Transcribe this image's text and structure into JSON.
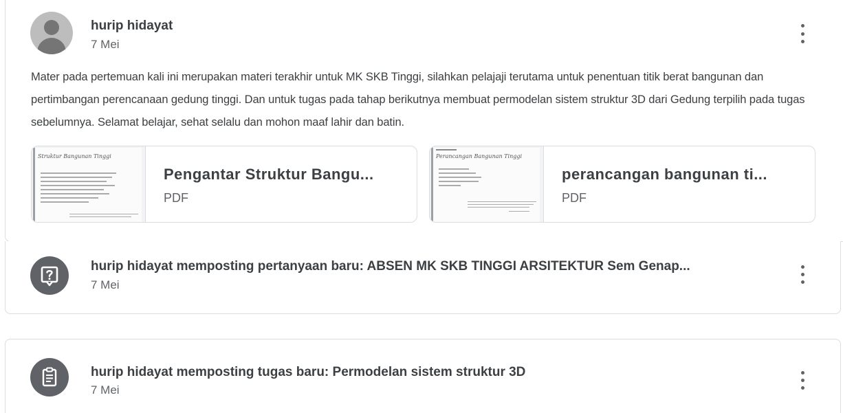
{
  "announcement": {
    "author": "hurip hidayat",
    "date": "7 Mei",
    "text": "Mater pada pertemuan kali ini merupakan materi terakhir untuk MK SKB Tinggi, silahkan pelajaji terutama untuk penentuan titik berat bangunan dan pertimbangan perencanaan gedung tinggi. Dan untuk tugas pada tahap berikutnya membuat permodelan sistem struktur 3D dari Gedung terpilih pada tugas sebelumnya. Selamat belajar, sehat selalu dan mohon maaf lahir dan batin.",
    "attachments": [
      {
        "title": "Pengantar Struktur Bangu...",
        "type": "PDF",
        "thumb_title": "Struktur Bangunan Tinggi"
      },
      {
        "title": "perancangan bangunan ti...",
        "type": "PDF",
        "thumb_title": "Perancangan Bangunan Tinggi"
      }
    ]
  },
  "question_post": {
    "title": "hurip hidayat memposting pertanyaan baru: ABSEN MK SKB TINGGI ARSITEKTUR Sem Genap...",
    "date": "7 Mei",
    "icon": "question-icon"
  },
  "assignment_post": {
    "title": "hurip hidayat memposting tugas baru: Permodelan sistem struktur 3D",
    "date": "7 Mei",
    "icon": "assignment-icon"
  },
  "colors": {
    "border": "#dadce0",
    "text": "#3c4043",
    "secondary": "#5f6368",
    "icon_bg": "#5f6368"
  }
}
